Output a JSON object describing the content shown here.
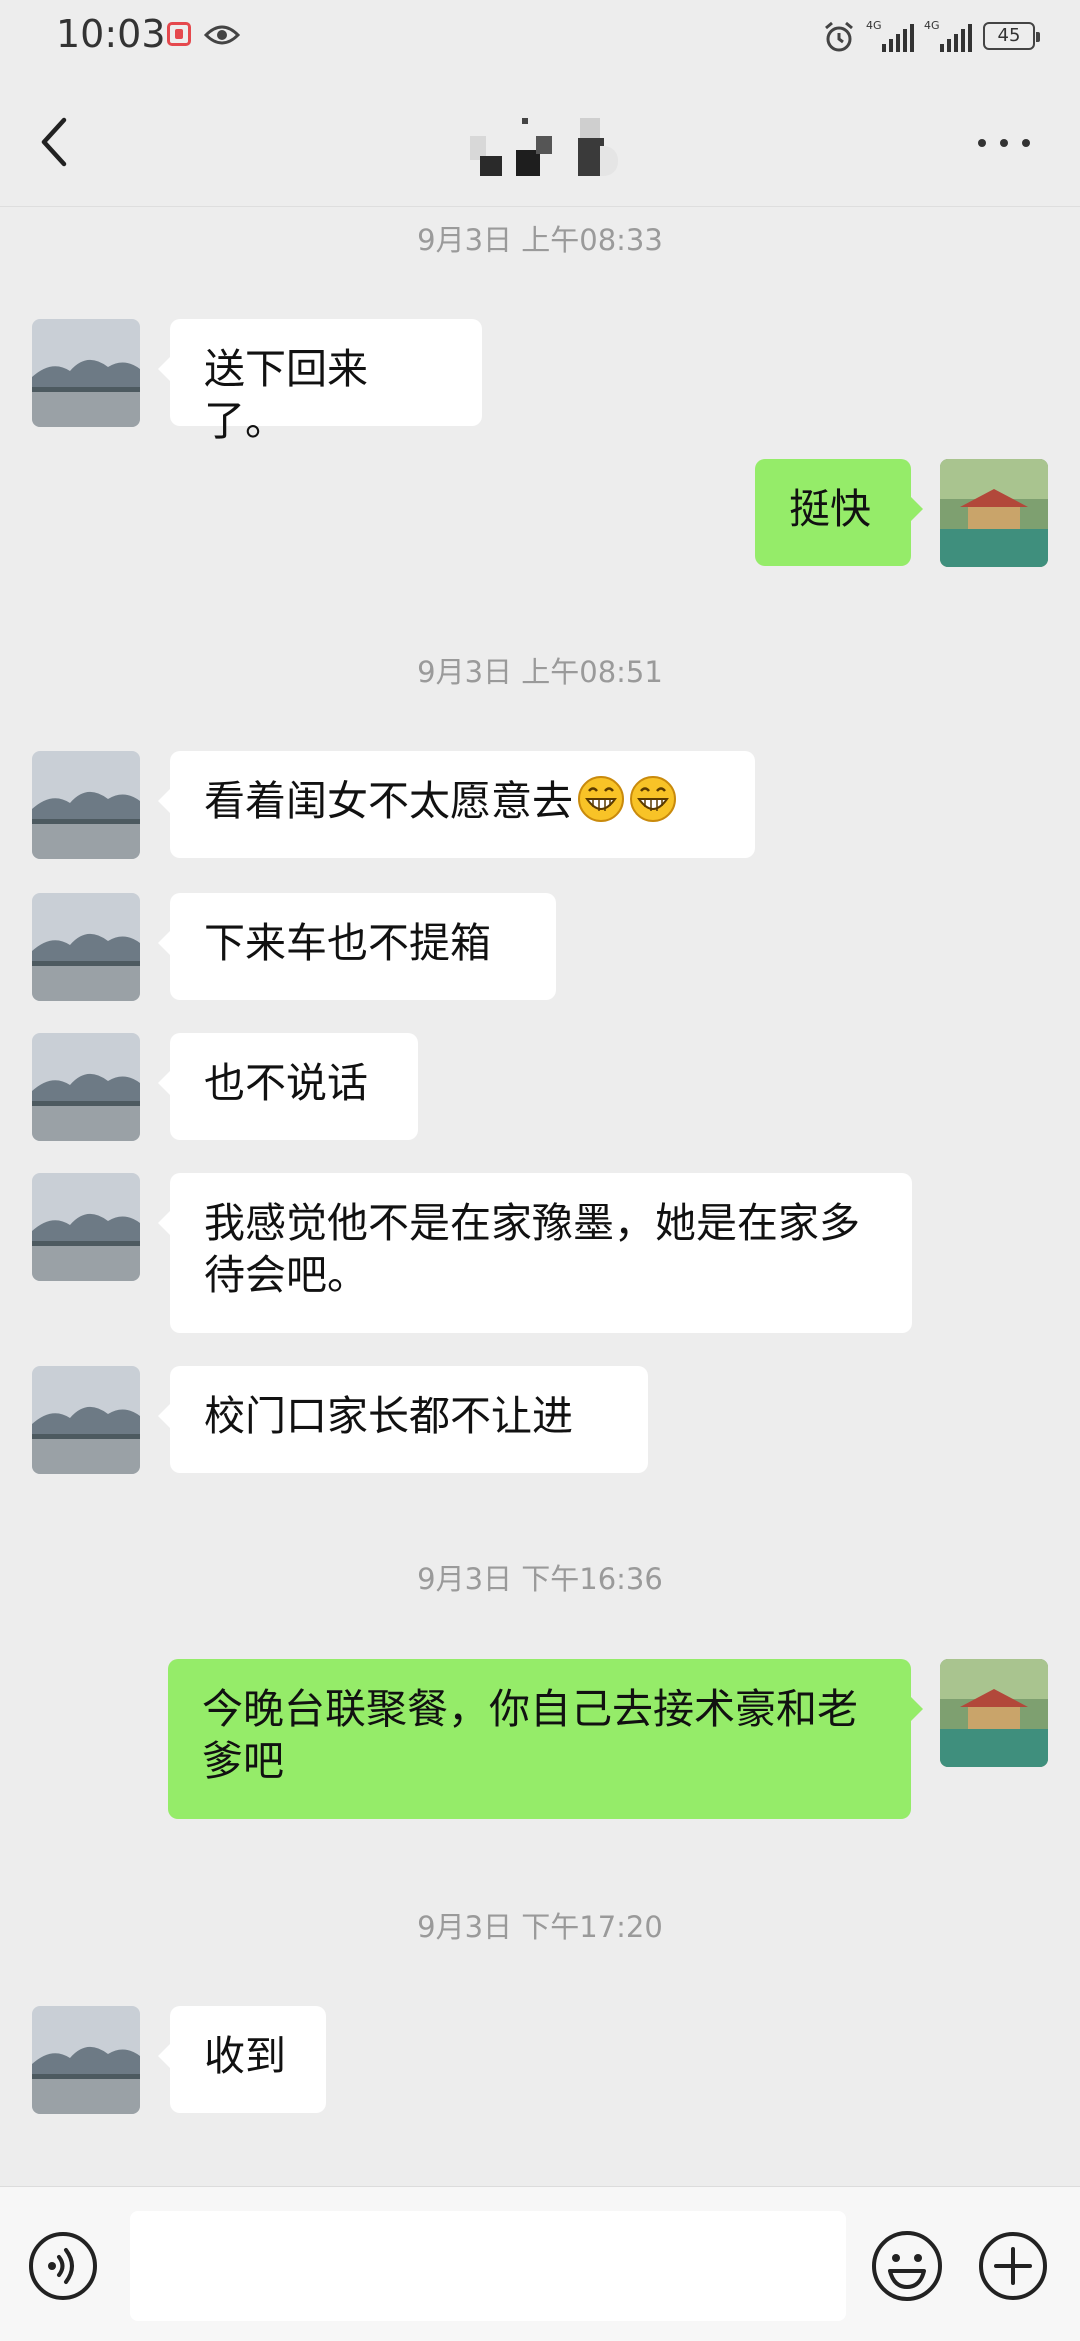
{
  "status_bar": {
    "time": "10:03",
    "signal1_label": "4G",
    "signal2_label": "4G",
    "battery": "45",
    "icons": [
      "notification-icon",
      "eye-icon",
      "alarm-icon",
      "signal-icon",
      "battery-icon"
    ]
  },
  "header": {
    "title": "",
    "back_icon": "chevron-left-icon",
    "more_icon": "more-dots-icon"
  },
  "timestamps": [
    "9月3日 上午08:33",
    "9月3日 上午08:51",
    "9月3日 下午16:36",
    "9月3日 下午17:20"
  ],
  "messages": [
    {
      "side": "in",
      "text": "送下回来了。"
    },
    {
      "side": "out",
      "text": "挺快"
    },
    {
      "side": "in",
      "text": "看着闺女不太愿意去",
      "emoji": [
        "grin-emoji",
        "grin-emoji"
      ]
    },
    {
      "side": "in",
      "text": "下来车也不提箱"
    },
    {
      "side": "in",
      "text": "也不说话"
    },
    {
      "side": "in",
      "text": "我感觉他不是在家豫墨，她是在家多待会吧。"
    },
    {
      "side": "in",
      "text": "校门口家长都不让进"
    },
    {
      "side": "out",
      "text": "今晚台联聚餐，你自己去接术豪和老爹吧"
    },
    {
      "side": "in",
      "text": "收到"
    }
  ],
  "input_bar": {
    "message_value": "",
    "icons": [
      "voice-icon",
      "emoji-icon",
      "plus-icon"
    ]
  },
  "colors": {
    "background": "#ededed",
    "incoming_bubble": "#ffffff",
    "outgoing_bubble": "#95ec69",
    "timestamp": "#9a9a9a"
  }
}
